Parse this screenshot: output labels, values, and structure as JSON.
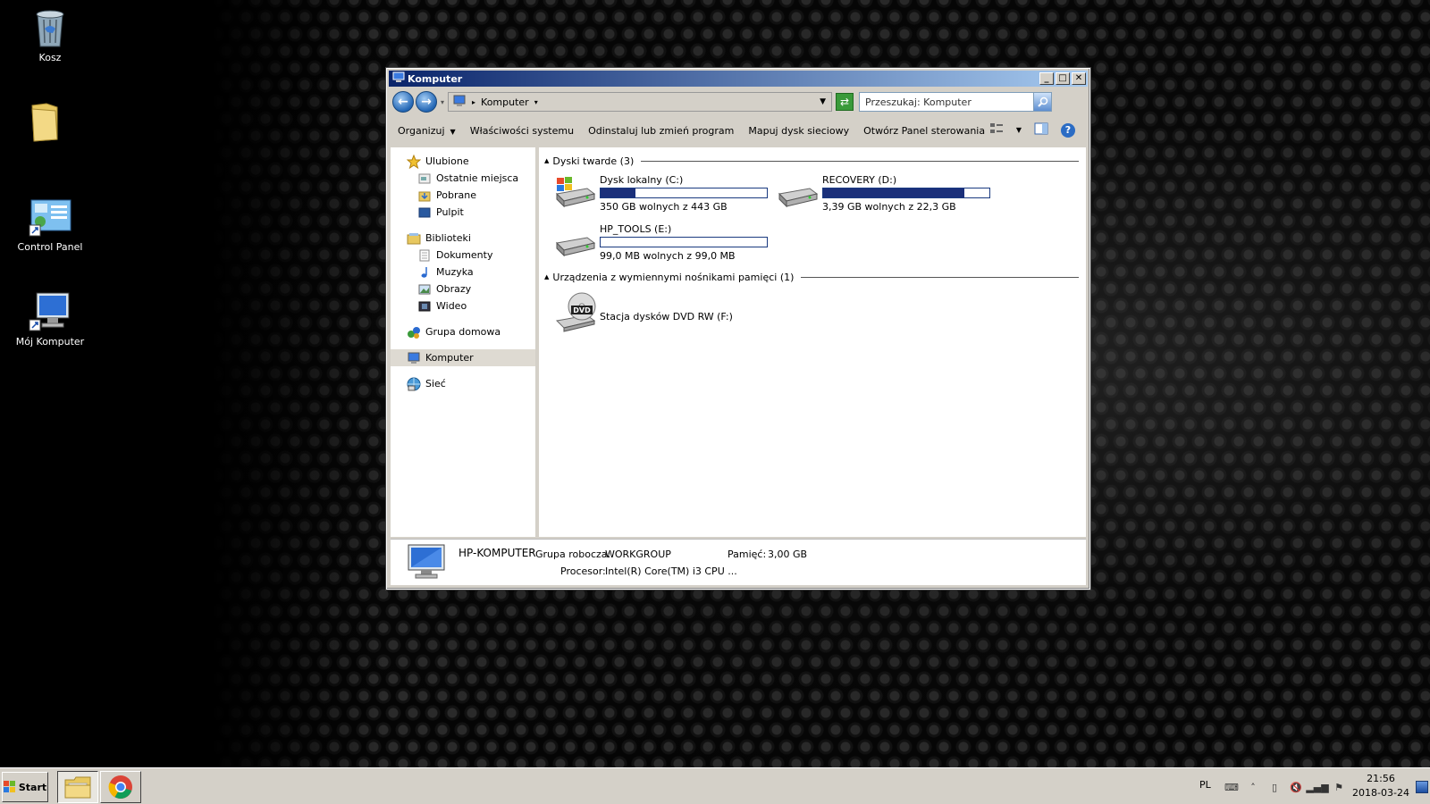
{
  "desktop": {
    "icons": [
      {
        "label": "Kosz",
        "icon": "recycle-bin-icon"
      },
      {
        "label": "",
        "icon": "folder-icon"
      },
      {
        "label": "Control Panel",
        "icon": "control-panel-icon"
      },
      {
        "label": "Mój Komputer",
        "icon": "computer-icon"
      }
    ]
  },
  "window": {
    "title": "Komputer",
    "buttons": {
      "minimize": "_",
      "maximize": "□",
      "close": "✕"
    },
    "address": {
      "path": "Komputer",
      "search_placeholder": "Przeszukaj: Komputer"
    },
    "commands": {
      "organize": "Organizuj",
      "system_properties": "Właściwości systemu",
      "uninstall": "Odinstaluj lub zmień program",
      "map_drive": "Mapuj dysk sieciowy",
      "control_panel": "Otwórz Panel sterowania",
      "help": "?"
    },
    "nav": {
      "favorites": {
        "label": "Ulubione",
        "items": [
          "Ostatnie miejsca",
          "Pobrane",
          "Pulpit"
        ]
      },
      "libraries": {
        "label": "Biblioteki",
        "items": [
          "Dokumenty",
          "Muzyka",
          "Obrazy",
          "Wideo"
        ]
      },
      "homegroup": "Grupa domowa",
      "computer": "Komputer",
      "network": "Sieć"
    },
    "content": {
      "hard_drives_header": "Dyski twarde (3)",
      "drives": [
        {
          "name": "Dysk lokalny (C:)",
          "free": "350 GB wolnych z 443 GB",
          "used_fraction": 0.21
        },
        {
          "name": "RECOVERY (D:)",
          "free": "3,39 GB wolnych z 22,3 GB",
          "used_fraction": 0.85
        },
        {
          "name": "HP_TOOLS (E:)",
          "free": "99,0 MB wolnych z 99,0 MB",
          "used_fraction": 0.0
        }
      ],
      "removable_header": "Urządzenia z wymiennymi nośnikami pamięci (1)",
      "dvd": {
        "name": "Stacja dysków DVD RW (F:)",
        "badge": "DVD"
      }
    },
    "details": {
      "computer_name": "HP-KOMPUTER",
      "workgroup_label": "Grupa robocza:",
      "workgroup_value": "WORKGROUP",
      "memory_label": "Pamięć:",
      "memory_value": "3,00 GB",
      "cpu_label": "Procesor:",
      "cpu_value": "Intel(R) Core(TM) i3 CPU ..."
    }
  },
  "taskbar": {
    "start_label": "Start",
    "language": "PL",
    "time": "21:56",
    "date": "2018-03-24"
  }
}
